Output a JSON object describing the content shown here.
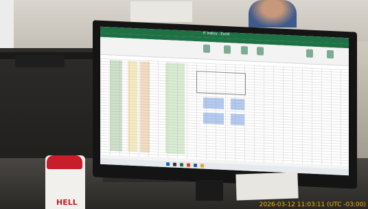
{
  "excel": {
    "window_title": "P. Índice - Excel",
    "brand_color": "#1e7145"
  },
  "jar": {
    "text": "HELL"
  },
  "timestamp": "2026-03-12 11:03:11 (UTC -03:00)"
}
